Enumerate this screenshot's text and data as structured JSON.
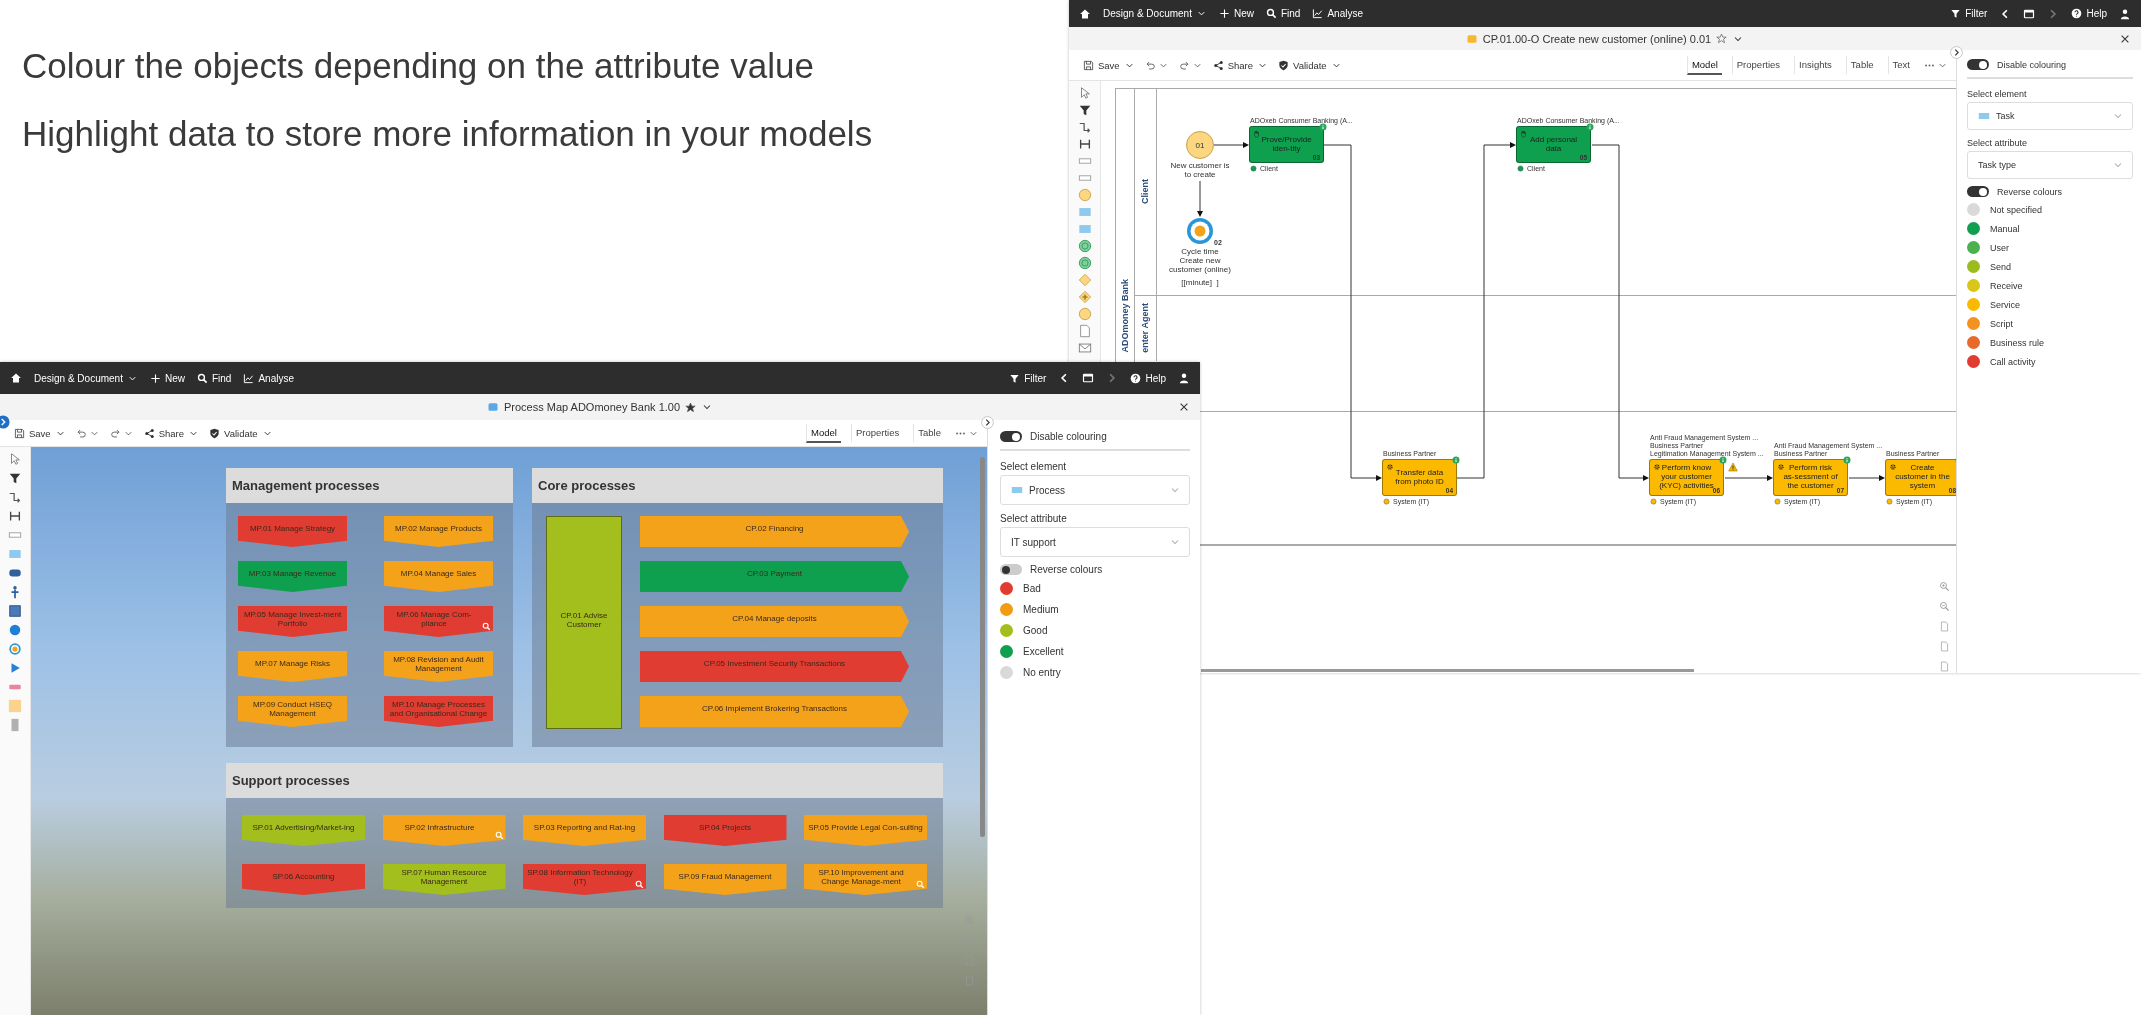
{
  "headline": [
    "Colour the objects depending on the attribute value",
    "Highlight data to store more information in your models"
  ],
  "right_screenshot": {
    "menu_bar": {
      "items": [
        {
          "label": "Design & Document",
          "kind": "menu"
        },
        {
          "label": "New",
          "kind": "new"
        },
        {
          "label": "Find",
          "kind": "find"
        },
        {
          "label": "Analyse",
          "kind": "analyse"
        }
      ],
      "filter": "Filter",
      "help": "Help"
    },
    "title": {
      "text": "CP.01.00-O Create new customer (online) 0.01",
      "kind": "process_model",
      "favorite": false
    },
    "toolbar": [
      {
        "label": "Save",
        "kind": "save"
      },
      {
        "label": "Share",
        "kind": "share"
      },
      {
        "label": "Validate",
        "kind": "validate"
      }
    ],
    "tabs": [
      {
        "label": "Model",
        "selected": true
      },
      {
        "label": "Properties",
        "selected": false
      },
      {
        "label": "Insights",
        "selected": false
      },
      {
        "label": "Table",
        "selected": false
      },
      {
        "label": "Text",
        "selected": false
      }
    ],
    "diagram": {
      "pool": "ADOmoney Bank",
      "lanes": [
        "Client",
        "enter Agent"
      ],
      "nodes": [
        {
          "kind": "start",
          "number": "01",
          "label": "New customer is to create"
        },
        {
          "kind": "task",
          "label": "Prove/Provide iden-tity",
          "number": "03",
          "color": "#0e9f4f",
          "annotations": [
            "ADOxeb Consumer Banking (A..."
          ],
          "performer": "Client",
          "warning": false
        },
        {
          "kind": "task",
          "label": "Add personal data",
          "number": "05",
          "color": "#0e9f4f",
          "annotations": [
            "ADOxeb Consumer Banking (A..."
          ],
          "performer": "Client",
          "warning": false
        },
        {
          "kind": "event",
          "number": "02",
          "label": "Cycle time Create new customer (online)",
          "unit": "[[minute]  ]"
        },
        {
          "kind": "task",
          "label": "Transfer data from photo ID",
          "number": "04",
          "color": "#fbb900",
          "annotations": [
            "Business Partner"
          ],
          "performer": "System (IT)",
          "warning": false
        },
        {
          "kind": "task",
          "label": "Perform know your customer (KYC) activities",
          "number": "06",
          "color": "#fbb900",
          "annotations": [
            "Anti Fraud Management System ...",
            "Business Partner",
            "Legitimation Management System ..."
          ],
          "performer": "System (IT)",
          "warning": true
        },
        {
          "kind": "task",
          "label": "Perform risk as-sessment of the customer",
          "number": "07",
          "color": "#fbb900",
          "annotations": [
            "Anti Fraud Management System ...",
            "Business Partner"
          ],
          "performer": "System (IT)",
          "warning": false
        },
        {
          "kind": "task",
          "label": "Create customer in the system",
          "number": "08",
          "color": "#fbb900",
          "annotations": [
            "Business Partner"
          ],
          "performer": "System (IT)",
          "warning": false
        }
      ]
    },
    "colouring_panel": {
      "disable_colouring": {
        "label": "Disable colouring",
        "on": true
      },
      "select_element": {
        "label": "Select element",
        "value": "Task"
      },
      "select_attribute": {
        "label": "Select attribute",
        "value": "Task type"
      },
      "reverse_colours": {
        "label": "Reverse colours",
        "on": true
      },
      "legend": [
        {
          "label": "Not specified",
          "color": "#d9d9d9"
        },
        {
          "label": "Manual",
          "color": "#0e9f4f"
        },
        {
          "label": "User",
          "color": "#4caf50"
        },
        {
          "label": "Send",
          "color": "#9bbb1f"
        },
        {
          "label": "Receive",
          "color": "#d9c61a"
        },
        {
          "label": "Service",
          "color": "#fbb900"
        },
        {
          "label": "Script",
          "color": "#f39221"
        },
        {
          "label": "Business rule",
          "color": "#e8692a"
        },
        {
          "label": "Call activity",
          "color": "#e03c31"
        }
      ]
    }
  },
  "left_screenshot": {
    "menu_bar": {
      "items": [
        {
          "label": "Design & Document",
          "kind": "menu"
        },
        {
          "label": "New",
          "kind": "new"
        },
        {
          "label": "Find",
          "kind": "find"
        },
        {
          "label": "Analyse",
          "kind": "analyse"
        }
      ],
      "filter": "Filter",
      "help": "Help"
    },
    "title": {
      "text": "Process Map ADOmoney Bank 1.00",
      "kind": "process_map",
      "favorite": true
    },
    "toolbar": [
      {
        "label": "Save",
        "kind": "save"
      },
      {
        "label": "Share",
        "kind": "share"
      },
      {
        "label": "Validate",
        "kind": "validate"
      }
    ],
    "tabs": [
      {
        "label": "Model",
        "selected": true
      },
      {
        "label": "Properties",
        "selected": false
      },
      {
        "label": "Table",
        "selected": false
      }
    ],
    "process_map": {
      "groups": [
        {
          "title": "Management processes",
          "kind": "grid",
          "processes": [
            {
              "label": "MP.01 Manage Strategy",
              "kind": "chevron",
              "color": "#e03c31",
              "has_detail": false
            },
            {
              "label": "MP.02 Manage Products",
              "kind": "chevron",
              "color": "#f5a21b",
              "has_detail": false
            },
            {
              "label": "MP.03 Manage Revenue",
              "kind": "chevron",
              "color": "#0e9f4f",
              "has_detail": false
            },
            {
              "label": "MP.04 Manage Sales",
              "kind": "chevron",
              "color": "#f5a21b",
              "has_detail": false
            },
            {
              "label": "MP.05 Manage Invest-ment Portfolio",
              "kind": "chevron",
              "color": "#e03c31",
              "has_detail": false
            },
            {
              "label": "MP.06 Manage Com-pliance",
              "kind": "chevron",
              "color": "#e03c31",
              "has_detail": true
            },
            {
              "label": "MP.07 Manage Risks",
              "kind": "chevron",
              "color": "#f5a21b",
              "has_detail": false
            },
            {
              "label": "MP.08 Revision and Audit Management",
              "kind": "chevron",
              "color": "#f5a21b",
              "has_detail": false
            },
            {
              "label": "MP.09 Conduct HSEQ Management",
              "kind": "chevron",
              "color": "#f5a21b",
              "has_detail": false
            },
            {
              "label": "MP.10 Manage Processes and Organisational Change",
              "kind": "chevron",
              "color": "#e03c31",
              "has_detail": false
            }
          ]
        },
        {
          "title": "Core processes",
          "kind": "core",
          "processes": [
            {
              "label": "CP.01 Advise Customer",
              "kind": "block",
              "color": "#a3bf1d",
              "has_detail": false
            },
            {
              "label": "CP.02 Financing",
              "kind": "arrow",
              "color": "#f5a21b",
              "has_detail": false
            },
            {
              "label": "CP.03 Payment",
              "kind": "arrow",
              "color": "#0e9f4f",
              "has_detail": false
            },
            {
              "label": "CP.04 Manage deposits",
              "kind": "arrow",
              "color": "#f5a21b",
              "has_detail": false
            },
            {
              "label": "CP.05 Investment Security Transactions",
              "kind": "arrow",
              "color": "#e03c31",
              "has_detail": false
            },
            {
              "label": "CP.06 Implement Brokering Transactions",
              "kind": "arrow",
              "color": "#f5a21b",
              "has_detail": false
            }
          ]
        },
        {
          "title": "Support processes",
          "kind": "row",
          "processes": [
            {
              "label": "SP.01 Advertising/Market-ing",
              "kind": "chevron",
              "color": "#a3bf1d",
              "has_detail": false
            },
            {
              "label": "SP.02 Infrastructure",
              "kind": "chevron",
              "color": "#f5a21b",
              "has_detail": true
            },
            {
              "label": "SP.03 Reporting and Rat-ing",
              "kind": "chevron",
              "color": "#f5a21b",
              "has_detail": false
            },
            {
              "label": "SP.04 Projects",
              "kind": "chevron",
              "color": "#e03c31",
              "has_detail": false
            },
            {
              "label": "SP.05 Provide Legal Con-sulting",
              "kind": "chevron",
              "color": "#f5a21b",
              "has_detail": false
            },
            {
              "label": "SP.06 Accounting",
              "kind": "chevron",
              "color": "#e03c31",
              "has_detail": false
            },
            {
              "label": "SP.07 Human Resource Management",
              "kind": "chevron",
              "color": "#a3bf1d",
              "has_detail": false
            },
            {
              "label": "SP.08 Information Technology (IT)",
              "kind": "chevron",
              "color": "#e03c31",
              "has_detail": true
            },
            {
              "label": "SP.09 Fraud Management",
              "kind": "chevron",
              "color": "#f5a21b",
              "has_detail": false
            },
            {
              "label": "SP.10 Improvement and Change Manage-ment",
              "kind": "chevron",
              "color": "#f5a21b",
              "has_detail": true
            }
          ]
        }
      ]
    },
    "colouring_panel": {
      "disable_colouring": {
        "label": "Disable colouring",
        "on": true
      },
      "select_element": {
        "label": "Select element",
        "value": "Process"
      },
      "select_attribute": {
        "label": "Select attribute",
        "value": "IT support"
      },
      "reverse_colours": {
        "label": "Reverse colours",
        "on": false
      },
      "legend": [
        {
          "label": "Bad",
          "color": "#e03c31"
        },
        {
          "label": "Medium",
          "color": "#f39c12"
        },
        {
          "label": "Good",
          "color": "#a3bf1d"
        },
        {
          "label": "Excellent",
          "color": "#0e9f4f"
        },
        {
          "label": "No entry",
          "color": "#d9d9d9"
        }
      ]
    }
  }
}
